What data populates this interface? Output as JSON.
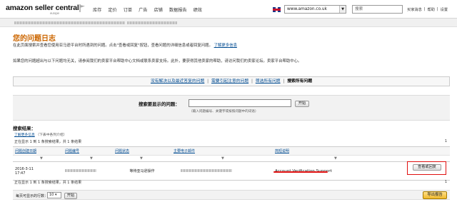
{
  "header": {
    "logo": "amazon seller central",
    "logo_sub": "europe",
    "nav": [
      "库存",
      "定价",
      "订单",
      "广告",
      "店铺",
      "数据报告",
      "绩效"
    ],
    "marketplace": "www.amazon.co.uk",
    "search_placeholder": "搜索",
    "links": [
      "买家消息",
      "帮助",
      "设置"
    ]
  },
  "page": {
    "title": "您的问题日志",
    "intro_text": "在此页面搜索并查看您使用亚马逊平台时所遇到的问题。点击\"查看或回复\"按钮，查看问题的详细信息或者回复问题。",
    "intro_link": "了解更多信息",
    "intro2_a": "如果您的问题超出与以下问题均无关，请参阅我们的",
    "intro2_link1": "卖家平台帮助中心文档",
    "intro2_mid": "或",
    "intro2_link2": "联系卖家支持",
    "intro2_b": "。此外，要获得其他卖家的帮助，请访问我们的",
    "intro2_link3": "卖家论坛",
    "intro2_c": "。",
    "intro2_link4": "卖家平台帮助中心",
    "intro2_end": "。"
  },
  "filters": {
    "f1": "没有解决以及最近答复的问题",
    "f2": "需要引起注意的问题",
    "f3": "筛选所有问题",
    "f4": "搜索所有问题"
  },
  "search": {
    "label": "搜索要显示的问题：",
    "go": "开始",
    "hint": "（输入问题编号、关键字或按照问题中的词语）"
  },
  "results": {
    "label": "搜索结果：",
    "link": "了解更多信息",
    "link_note": "（下表中各列介绍）",
    "count_top": "正在显示 1 到 1 条搜索结果，共 1 条结果",
    "page": "1",
    "count_bottom": "正在显示 1 到 1 条搜索结果，共 1 条结果"
  },
  "table": {
    "headers": [
      "问题创建日期",
      "问题编号",
      "问题状态",
      "主要电子邮件",
      "简短说明",
      ""
    ],
    "sort_hint": "▼",
    "rows": [
      {
        "date": "2016-3-11",
        "time": "17:47",
        "status": "等待亚马逊操作",
        "summary": "Account Verification Support",
        "action": "查看或回复"
      }
    ]
  },
  "bottom": {
    "per_page_label": "每页可显示的行数：",
    "per_page_value": "10",
    "go": "开始",
    "export": "导出报告"
  }
}
